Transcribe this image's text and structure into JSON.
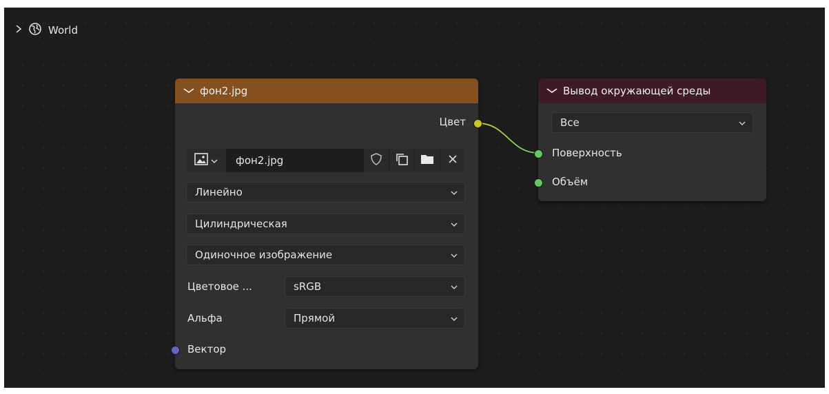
{
  "breadcrumb": {
    "label": "World"
  },
  "image_node": {
    "title": "фон2.jpg",
    "output_socket": "Цвет",
    "image_name": "фон2.jpg",
    "interpolation": "Линейно",
    "projection": "Цилиндрическая",
    "extension": "Одиночное изображение",
    "color_space_label": "Цветовое ...",
    "color_space_value": "sRGB",
    "alpha_label": "Альфа",
    "alpha_value": "Прямой",
    "input_socket": "Вектор"
  },
  "output_node": {
    "title": "Вывод окружающей среды",
    "target": "Все",
    "input_surface": "Поверхность",
    "input_volume": "Объём"
  },
  "colors": {
    "image_header": "#84501f",
    "output_header": "#3f1b26",
    "color_socket": "#c7c729",
    "shader_socket": "#63c763",
    "vector_socket": "#6363c7"
  }
}
